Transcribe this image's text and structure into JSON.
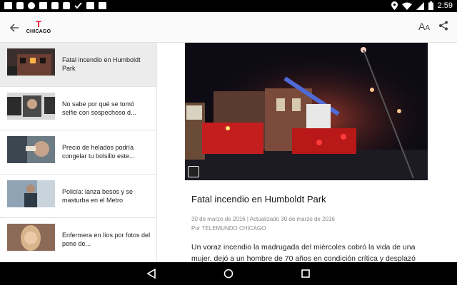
{
  "status_bar": {
    "time": "2:59",
    "left_icons": [
      "image-icon",
      "notification-icon",
      "android-icon",
      "gallery-icon",
      "notification-icon",
      "notification-icon",
      "check-icon",
      "sim-icon",
      "camera-icon"
    ],
    "right_icons": [
      "location-icon",
      "wifi-icon",
      "signal-icon",
      "battery-icon"
    ]
  },
  "app_bar": {
    "logo_text": "CHICAGO",
    "text_size_label": "A",
    "text_size_small": "A"
  },
  "sidebar": {
    "items": [
      {
        "title": "Fatal incendio en Humboldt Park",
        "thumb": "fire-building-thumb"
      },
      {
        "title": "No sabe por qué se tomó selfie con sospechoso d...",
        "thumb": "car-selfie-thumb"
      },
      {
        "title": "Precio de helados podría congelar tu bolsillo este...",
        "thumb": "ice-cream-thumb"
      },
      {
        "title": "Policía: lanza besos y se masturba en el Metro",
        "thumb": "metro-thumb"
      },
      {
        "title": "Enfermera en líos por fotos del pene de...",
        "thumb": "nurse-thumb"
      }
    ]
  },
  "article": {
    "title": "Fatal incendio en Humboldt Park",
    "dates": "30 de marzo de 2016 | Actualizado 30 de marzo de 2016",
    "author": "Por TELEMUNDO CHICAGO",
    "body": "Un voraz incendio la madrugada del miércoles cobró la vida de una mujer, dejó a un hombre de 70 años en condición crítica y desplazó"
  },
  "colors": {
    "brand_red": "#e4002b",
    "active_item_bg": "#ececec"
  }
}
